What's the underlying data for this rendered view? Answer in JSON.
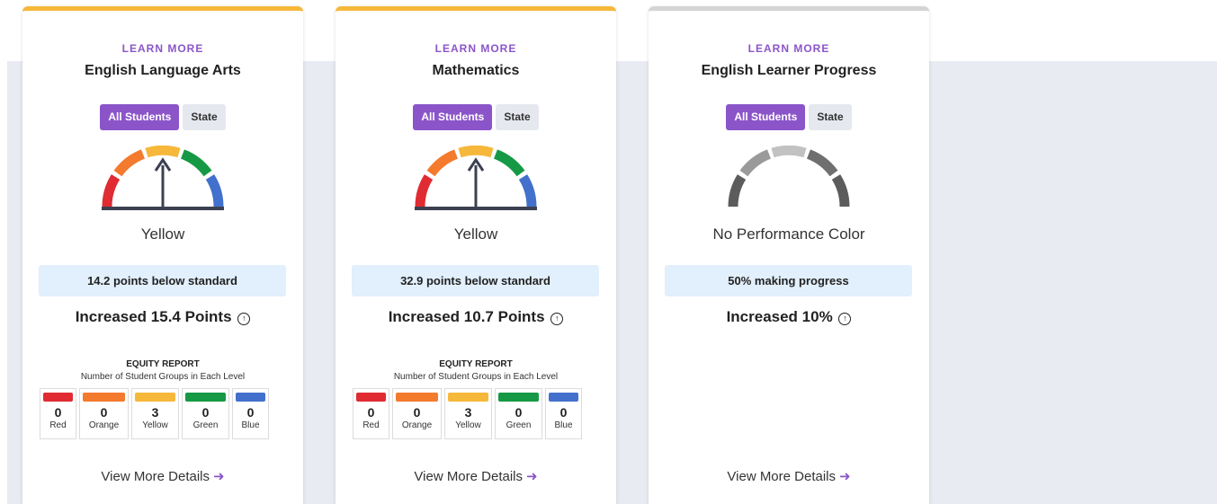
{
  "colors": {
    "accent": "#8b55c9",
    "red": "#e02b32",
    "orange": "#f47a2e",
    "yellow": "#f6b83a",
    "green": "#159944",
    "blue": "#4270cc",
    "no_color": "#6f6f6f"
  },
  "cards": [
    {
      "learn_more": "LEARN MORE",
      "title": "English Language Arts",
      "toggle_all": "All Students",
      "toggle_state": "State",
      "gauge_level": "yellow",
      "performance_color": "Yellow",
      "standard_text": "14.2 points below standard",
      "change_text": "Increased 15.4 Points",
      "change_icon": "arrow-up-circle-icon",
      "equity_title": "EQUITY REPORT",
      "equity_subtitle": "Number of Student Groups in Each Level",
      "levels": [
        {
          "count": "0",
          "name": "Red"
        },
        {
          "count": "0",
          "name": "Orange"
        },
        {
          "count": "3",
          "name": "Yellow"
        },
        {
          "count": "0",
          "name": "Green"
        },
        {
          "count": "0",
          "name": "Blue"
        }
      ],
      "details_link": "View More Details",
      "details_icon": "arrow-right-icon"
    },
    {
      "learn_more": "LEARN MORE",
      "title": "Mathematics",
      "toggle_all": "All Students",
      "toggle_state": "State",
      "gauge_level": "yellow",
      "performance_color": "Yellow",
      "standard_text": "32.9 points below standard",
      "change_text": "Increased 10.7 Points",
      "change_icon": "arrow-up-circle-icon",
      "equity_title": "EQUITY REPORT",
      "equity_subtitle": "Number of Student Groups in Each Level",
      "levels": [
        {
          "count": "0",
          "name": "Red"
        },
        {
          "count": "0",
          "name": "Orange"
        },
        {
          "count": "3",
          "name": "Yellow"
        },
        {
          "count": "0",
          "name": "Green"
        },
        {
          "count": "0",
          "name": "Blue"
        }
      ],
      "details_link": "View More Details",
      "details_icon": "arrow-right-icon"
    },
    {
      "learn_more": "LEARN MORE",
      "title": "English Learner Progress",
      "toggle_all": "All Students",
      "toggle_state": "State",
      "gauge_level": "none",
      "performance_color": "No Performance Color",
      "standard_text": "50% making progress",
      "change_text": "Increased 10%",
      "change_icon": "arrow-up-circle-icon",
      "details_link": "View More Details",
      "details_icon": "arrow-right-icon"
    }
  ]
}
